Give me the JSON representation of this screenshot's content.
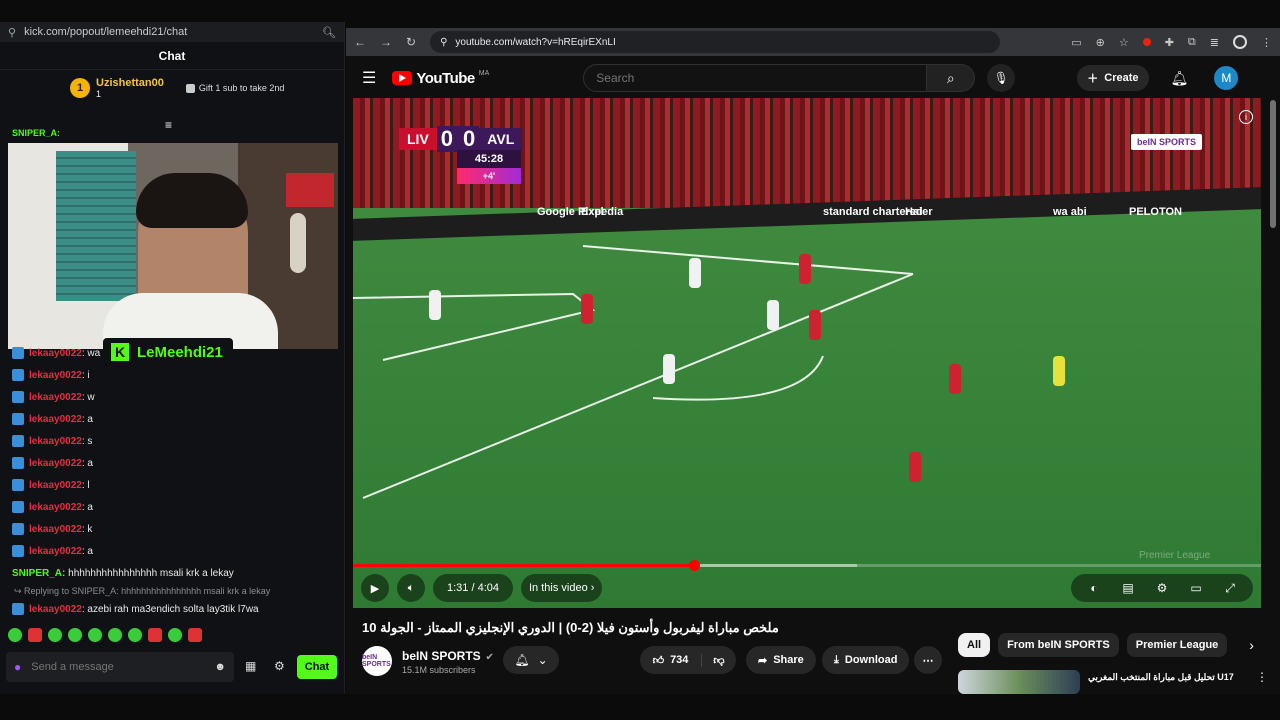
{
  "kick": {
    "url": "kick.com/popout/lemeehdi21/chat",
    "chat_header": "Chat",
    "top_gifter": {
      "rank": "1",
      "name": "Uzishettan00",
      "subs": "1"
    },
    "gift_prompt": "Gift 1 sub to take 2nd",
    "pinned_user": "SNIPER_A:",
    "streamer_name": "LeMeehdi21",
    "messages": [
      {
        "user": "lekaay0022",
        "text": ": wa"
      },
      {
        "user": "lekaay0022",
        "text": ": i"
      },
      {
        "user": "lekaay0022",
        "text": ": w"
      },
      {
        "user": "lekaay0022",
        "text": ": a"
      },
      {
        "user": "lekaay0022",
        "text": ": s"
      },
      {
        "user": "lekaay0022",
        "text": ": a"
      },
      {
        "user": "lekaay0022",
        "text": ": l"
      },
      {
        "user": "lekaay0022",
        "text": ": a"
      },
      {
        "user": "lekaay0022",
        "text": ": k"
      },
      {
        "user": "lekaay0022",
        "text": ": a"
      }
    ],
    "sniper_message": {
      "user": "SNIPER_A:",
      "text": "hhhhhhhhhhhhhhhh msali krk a lekay"
    },
    "reply_context": "Replying to SNIPER_A: hhhhhhhhhhhhhhhh msali krk a lekay",
    "reply_message": {
      "user": "lekaay0022",
      "text": ": azebi rah ma3endich solta lay3tik l7wa"
    },
    "composer_placeholder": "Send a message",
    "chat_button": "Chat"
  },
  "browser": {
    "url": "youtube.com/watch?v=hREqirEXnLI"
  },
  "youtube": {
    "logo_text": "YouTube",
    "region": "MA",
    "search_placeholder": "Search",
    "create_label": "Create",
    "avatar_letter": "M",
    "video": {
      "home_team": "LIV",
      "away_team": "AVL",
      "home_score": "0",
      "away_score": "0",
      "match_clock": "45:28",
      "added_time": "+4'",
      "broadcaster": "beIN SPORTS",
      "watermark": "Premier League",
      "elapsed": "1:31 / 4:04",
      "progress_fraction": 0.375,
      "buffered_fraction": 0.555,
      "in_this_video": "In this video",
      "ads": [
        "Google Pixel",
        "Expedia",
        "standard chartered",
        "Haier",
        "wa abi",
        "PELOTON"
      ]
    },
    "title": "ملخص مباراة ليفربول وأستون فيلا (2-0) | الدوري الإنجليزي الممتاز - الجولة 10",
    "channel": {
      "name": "beIN SPORTS",
      "subscribers": "15.1M subscribers",
      "avatar_text": "beIN SPORTS"
    },
    "likes": "734",
    "share_label": "Share",
    "download_label": "Download",
    "chips": [
      "All",
      "From beIN SPORTS",
      "Premier League"
    ],
    "recommendation_title": "U17 تحليل قبل مباراة المنتخب المغربي"
  },
  "colors": {
    "kick_green": "#53fc18",
    "youtube_red": "#ff0000",
    "chat_user": "#e2303f"
  }
}
